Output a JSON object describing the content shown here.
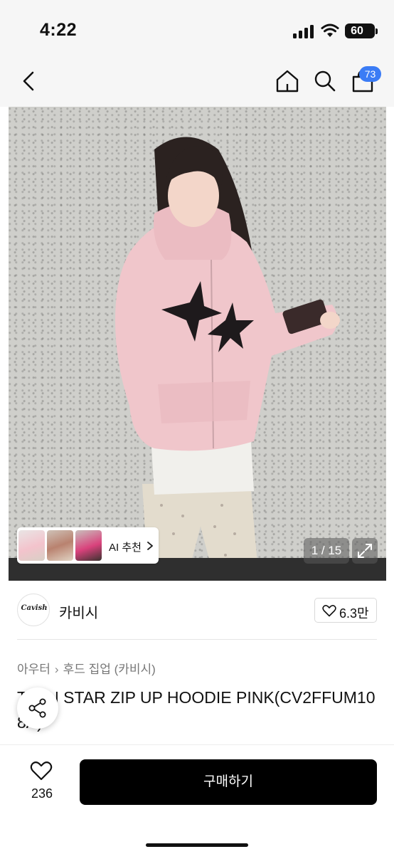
{
  "status_bar": {
    "time": "4:22",
    "battery": "60"
  },
  "nav": {
    "cart_badge": "73"
  },
  "gallery": {
    "counter": "1 / 15",
    "ai_label": "AI 추천"
  },
  "seller": {
    "name": "카비시",
    "logo_text": "Cavish",
    "likes": "6.3만"
  },
  "breadcrumb": [
    "아우터",
    "후드 집업 (카비시)"
  ],
  "product": {
    "title": "TWIN STAR ZIP UP HOODIE PINK(CV2FFUM108A)"
  },
  "actions": {
    "wish_count": "236",
    "buy_label": "구매하기"
  },
  "colors": {
    "accent": "#3b7cf5",
    "buy_button": "#000000",
    "hoodie": "#f0c6cb"
  },
  "icons": [
    "back-icon",
    "home-icon",
    "search-icon",
    "bag-icon",
    "expand-icon",
    "heart-icon",
    "share-icon",
    "chevron-right-icon"
  ]
}
